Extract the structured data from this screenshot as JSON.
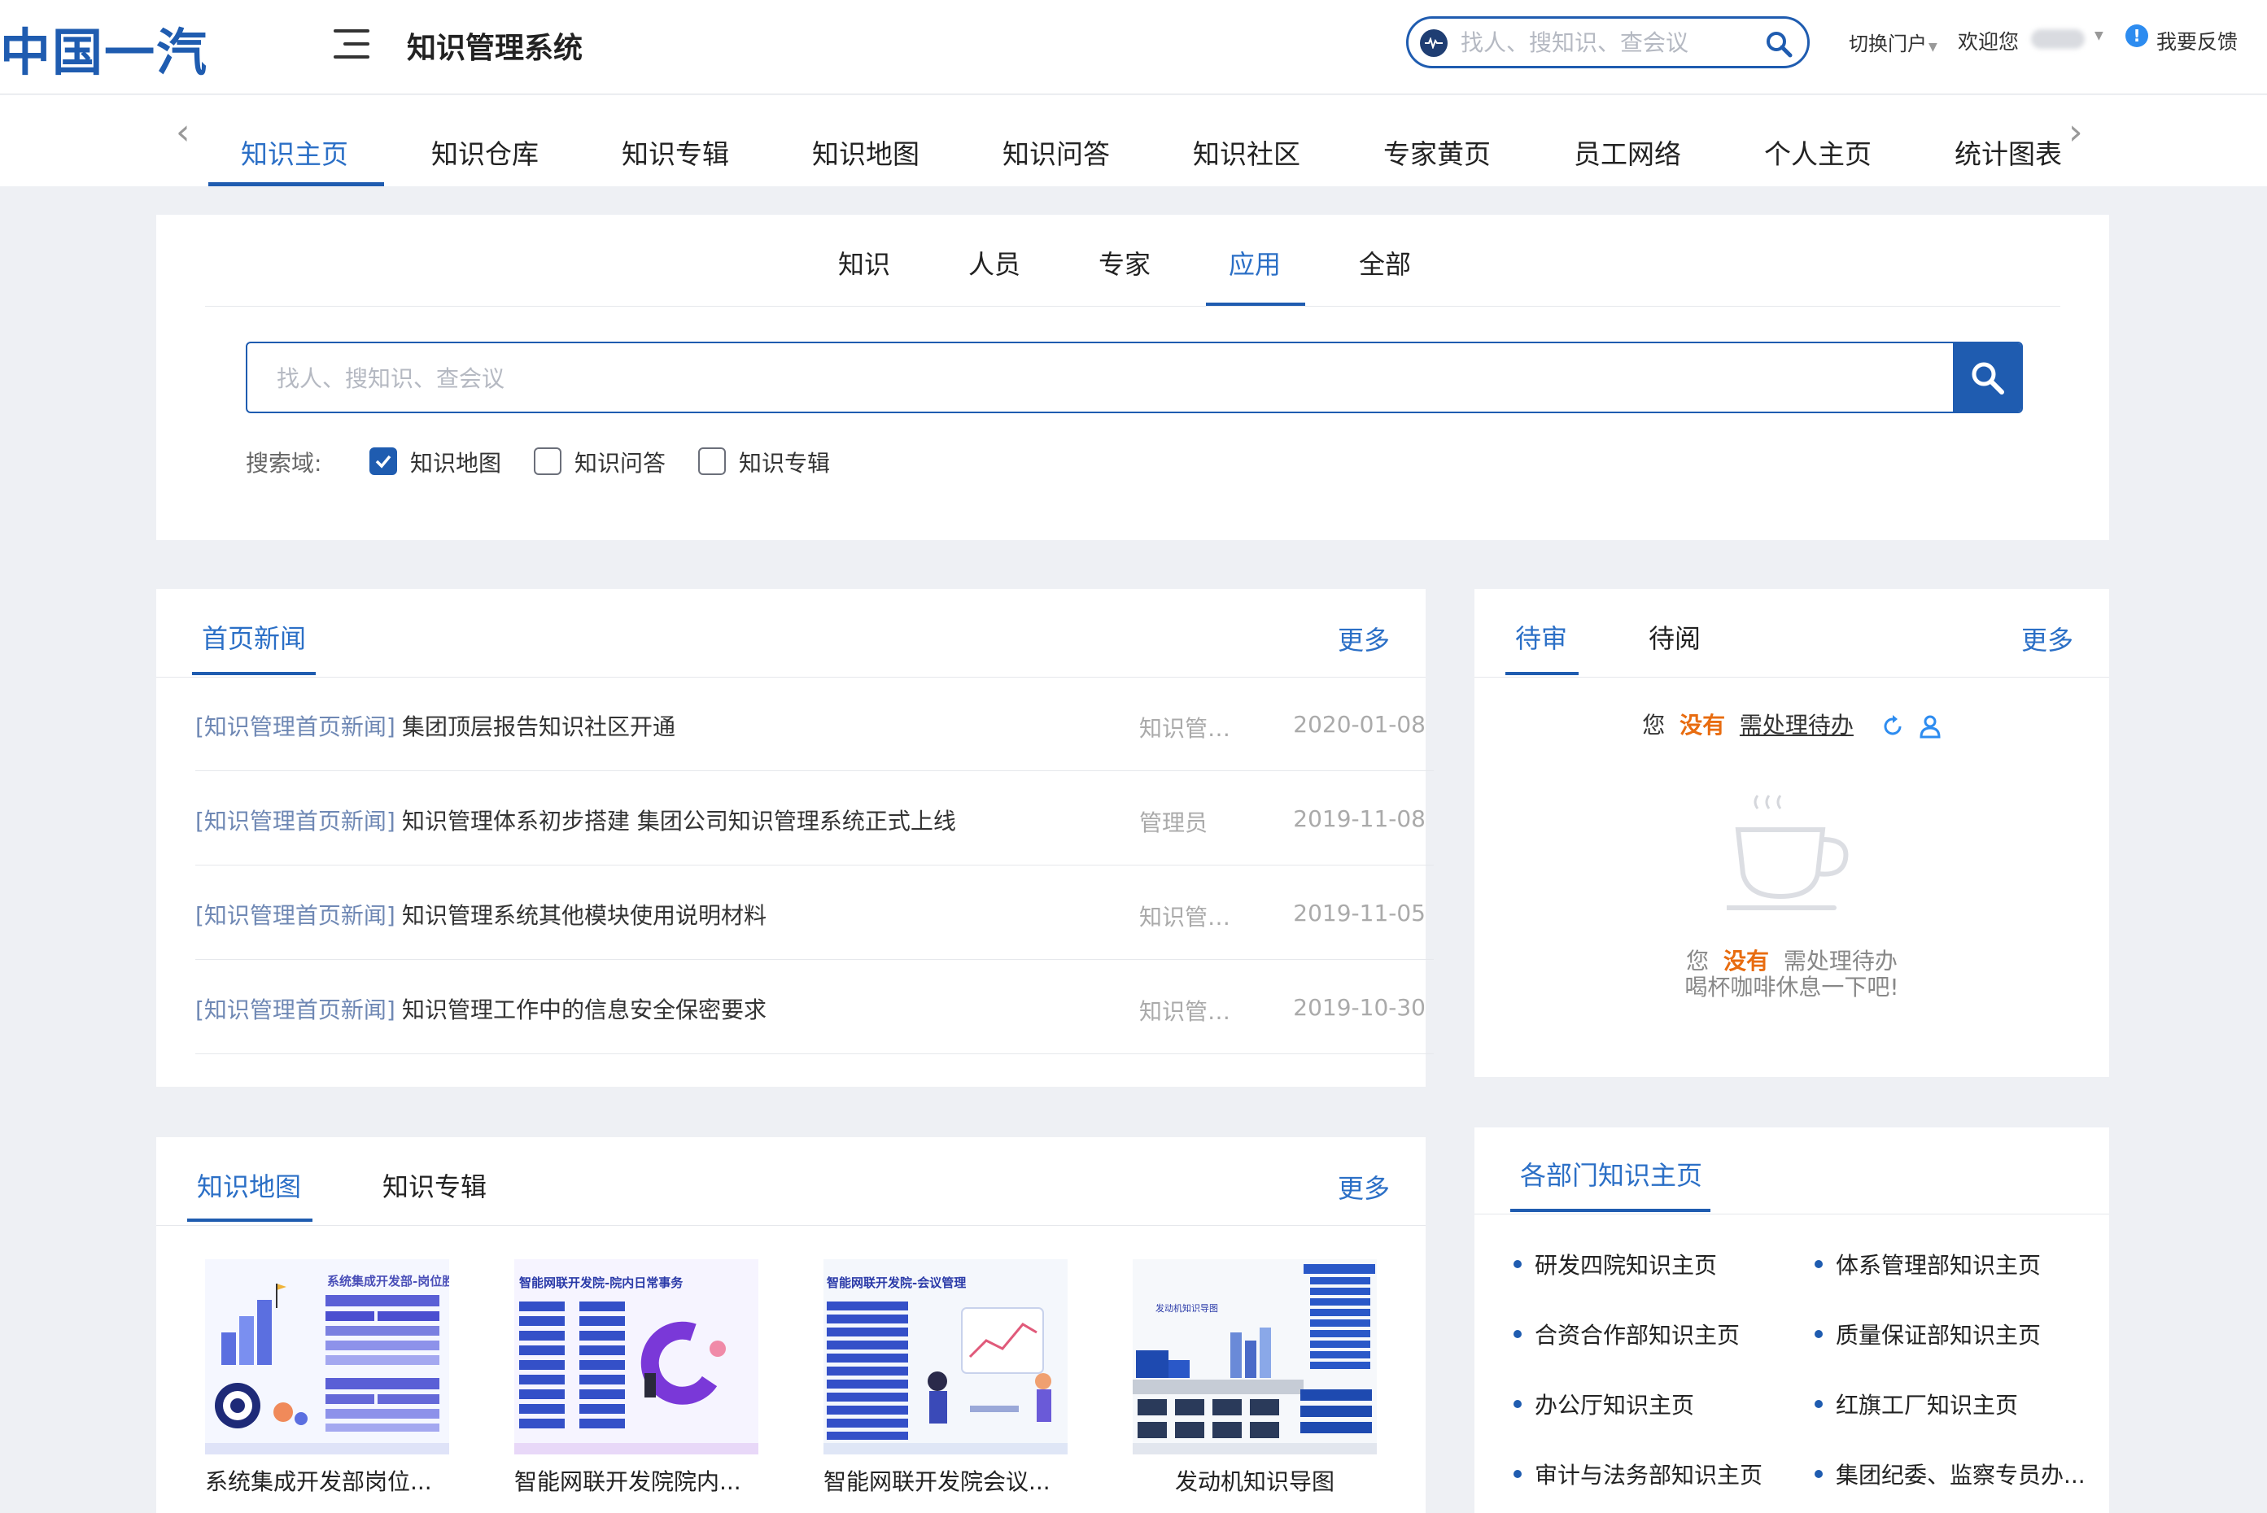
{
  "header": {
    "logo": "中国一汽",
    "system_title": "知识管理系统",
    "search_placeholder": "找人、搜知识、查会议",
    "portal_switch": "切换门户",
    "welcome": "欢迎您",
    "feedback": "我要反馈"
  },
  "nav": {
    "tabs": [
      "知识主页",
      "知识仓库",
      "知识专辑",
      "知识地图",
      "知识问答",
      "知识社区",
      "专家黄页",
      "员工网络",
      "个人主页",
      "统计图表"
    ],
    "active_index": 0
  },
  "search": {
    "tabs": [
      "知识",
      "人员",
      "专家",
      "应用",
      "全部"
    ],
    "active_index": 3,
    "placeholder": "找人、搜知识、查会议",
    "domain_label": "搜索域:",
    "domains": [
      {
        "label": "知识地图",
        "checked": true
      },
      {
        "label": "知识问答",
        "checked": false
      },
      {
        "label": "知识专辑",
        "checked": false
      }
    ]
  },
  "news": {
    "title": "首页新闻",
    "more": "更多",
    "items": [
      {
        "category": "[知识管理首页新闻]",
        "title": "集团顶层报告知识社区开通",
        "author": "知识管理员",
        "date": "2020-01-08"
      },
      {
        "category": "[知识管理首页新闻]",
        "title": "知识管理体系初步搭建 集团公司知识管理系统正式上线",
        "author": "管理员",
        "date": "2019-11-08"
      },
      {
        "category": "[知识管理首页新闻]",
        "title": "知识管理系统其他模块使用说明材料",
        "author": "知识管理员",
        "date": "2019-11-05"
      },
      {
        "category": "[知识管理首页新闻]",
        "title": "知识管理工作中的信息安全保密要求",
        "author": "知识管理员",
        "date": "2019-10-30"
      }
    ]
  },
  "pending": {
    "tabs": [
      "待审",
      "待阅"
    ],
    "more": "更多",
    "line_you": "您",
    "line_none": "没有",
    "line_link": "需处理待办",
    "empty_you": "您",
    "empty_none": "没有",
    "empty_rest": "需处理待办",
    "empty_sub": "喝杯咖啡休息一下吧!"
  },
  "knowledge_map": {
    "tabs": [
      "知识地图",
      "知识专辑"
    ],
    "more": "更多",
    "items": [
      {
        "caption": "系统集成开发部岗位...",
        "banner": "系统集成开发部-岗位胜任"
      },
      {
        "caption": "智能网联开发院院内...",
        "banner": "智能网联开发院-院内日常事务"
      },
      {
        "caption": "智能网联开发院会议...",
        "banner": "智能网联开发院-会议管理"
      },
      {
        "caption": "发动机知识导图",
        "banner": "发动机知识导图"
      }
    ]
  },
  "departments": {
    "title": "各部门知识主页",
    "items": [
      "研发四院知识主页",
      "体系管理部知识主页",
      "合资合作部知识主页",
      "质量保证部知识主页",
      "办公厅知识主页",
      "红旗工厂知识主页",
      "审计与法务部知识主页",
      "集团纪委、监察专员办..."
    ]
  },
  "colors": {
    "brand": "#1f5cb0",
    "accent_text": "#2b6fc6",
    "warning": "#e86c10"
  }
}
